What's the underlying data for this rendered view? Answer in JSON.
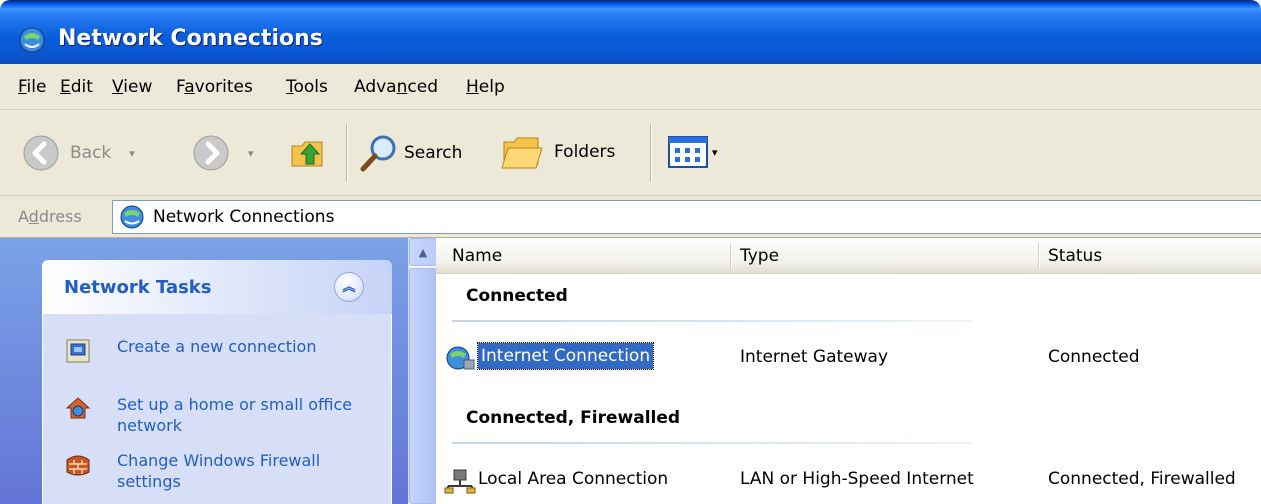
{
  "window": {
    "title": "Network Connections"
  },
  "menu": {
    "file": {
      "accel": "F",
      "rest": "ile"
    },
    "edit": {
      "accel": "E",
      "rest": "dit"
    },
    "view": {
      "accel": "V",
      "rest": "iew"
    },
    "favorites": {
      "pre": "F",
      "accel": "a",
      "rest": "vorites"
    },
    "tools": {
      "accel": "T",
      "rest": "ools"
    },
    "advanced": {
      "pre": "Adva",
      "accel": "n",
      "rest": "ced"
    },
    "help": {
      "accel": "H",
      "rest": "elp"
    }
  },
  "toolbar": {
    "back_label": "Back",
    "search_label": "Search",
    "folders_label": "Folders"
  },
  "address": {
    "label_pre": "A",
    "label_accel": "d",
    "label_rest": "dress",
    "value": "Network Connections"
  },
  "task_pane": {
    "header": "Network Tasks",
    "tasks": [
      {
        "label": "Create a new connection",
        "icon": "new-connection-icon"
      },
      {
        "label": "Set up a home or small office network",
        "icon": "home-network-icon"
      },
      {
        "label": "Change Windows Firewall settings",
        "icon": "firewall-icon"
      }
    ]
  },
  "list": {
    "columns": [
      "Name",
      "Type",
      "Status"
    ],
    "groups": [
      {
        "title": "Connected",
        "items": [
          {
            "name": "Internet Connection",
            "type": "Internet Gateway",
            "status": "Connected",
            "selected": true
          }
        ]
      },
      {
        "title": "Connected, Firewalled",
        "items": [
          {
            "name": "Local Area Connection",
            "type": "LAN or High-Speed Internet",
            "status": "Connected, Firewalled",
            "selected": false
          }
        ]
      }
    ]
  },
  "colors": {
    "title_blue": "#0a5fdb",
    "chrome": "#ece9d8",
    "task_link": "#215dc6",
    "selection": "#316ac5"
  }
}
